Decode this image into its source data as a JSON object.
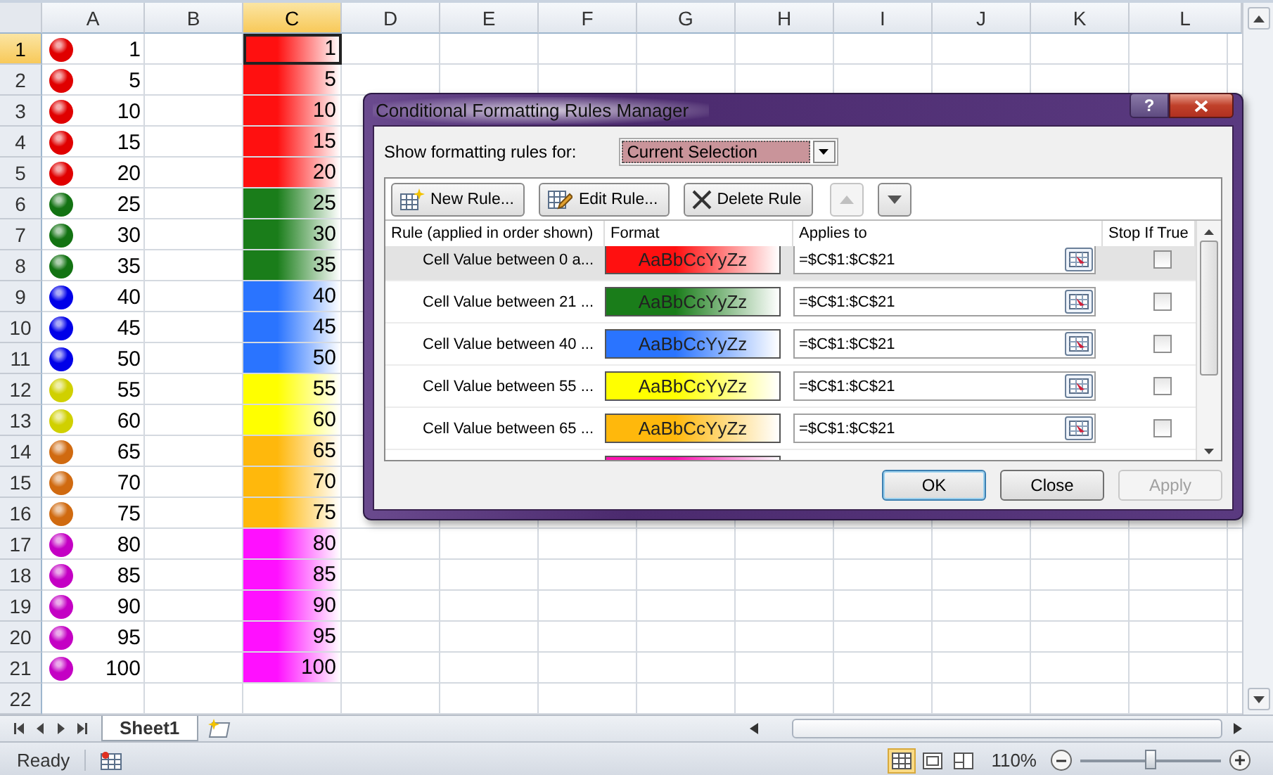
{
  "columns": [
    {
      "label": "A",
      "selected": false
    },
    {
      "label": "B",
      "selected": false
    },
    {
      "label": "C",
      "selected": true
    },
    {
      "label": "D",
      "selected": false
    },
    {
      "label": "E",
      "selected": false
    },
    {
      "label": "F",
      "selected": false
    },
    {
      "label": "G",
      "selected": false
    },
    {
      "label": "H",
      "selected": false
    },
    {
      "label": "I",
      "selected": false
    },
    {
      "label": "J",
      "selected": false
    },
    {
      "label": "K",
      "selected": false
    },
    {
      "label": "L",
      "selected": false
    }
  ],
  "rows": [
    {
      "number": "1",
      "selected": true,
      "dot": {
        "color": "#e00000"
      },
      "value_a": "1",
      "cell_c": {
        "value": "1",
        "color": "#ff1010"
      }
    },
    {
      "number": "2",
      "selected": false,
      "dot": {
        "color": "#e00000"
      },
      "value_a": "5",
      "cell_c": {
        "value": "5",
        "color": "#ff1010"
      }
    },
    {
      "number": "3",
      "selected": false,
      "dot": {
        "color": "#e00000"
      },
      "value_a": "10",
      "cell_c": {
        "value": "10",
        "color": "#ff1010"
      }
    },
    {
      "number": "4",
      "selected": false,
      "dot": {
        "color": "#e00000"
      },
      "value_a": "15",
      "cell_c": {
        "value": "15",
        "color": "#ff1010"
      }
    },
    {
      "number": "5",
      "selected": false,
      "dot": {
        "color": "#e00000"
      },
      "value_a": "20",
      "cell_c": {
        "value": "20",
        "color": "#ff1010"
      }
    },
    {
      "number": "6",
      "selected": false,
      "dot": {
        "color": "#137313"
      },
      "value_a": "25",
      "cell_c": {
        "value": "25",
        "color": "#1a7d1a"
      }
    },
    {
      "number": "7",
      "selected": false,
      "dot": {
        "color": "#137313"
      },
      "value_a": "30",
      "cell_c": {
        "value": "30",
        "color": "#1a7d1a"
      }
    },
    {
      "number": "8",
      "selected": false,
      "dot": {
        "color": "#137313"
      },
      "value_a": "35",
      "cell_c": {
        "value": "35",
        "color": "#1a7d1a"
      }
    },
    {
      "number": "9",
      "selected": false,
      "dot": {
        "color": "#0000e8"
      },
      "value_a": "40",
      "cell_c": {
        "value": "40",
        "color": "#2a74ff"
      }
    },
    {
      "number": "10",
      "selected": false,
      "dot": {
        "color": "#0000e8"
      },
      "value_a": "45",
      "cell_c": {
        "value": "45",
        "color": "#2a74ff"
      }
    },
    {
      "number": "11",
      "selected": false,
      "dot": {
        "color": "#0000e8"
      },
      "value_a": "50",
      "cell_c": {
        "value": "50",
        "color": "#2a74ff"
      }
    },
    {
      "number": "12",
      "selected": false,
      "dot": {
        "color": "#d0d000"
      },
      "value_a": "55",
      "cell_c": {
        "value": "55",
        "color": "#ffff00"
      }
    },
    {
      "number": "13",
      "selected": false,
      "dot": {
        "color": "#d0d000"
      },
      "value_a": "60",
      "cell_c": {
        "value": "60",
        "color": "#ffff00"
      }
    },
    {
      "number": "14",
      "selected": false,
      "dot": {
        "color": "#d06a10"
      },
      "value_a": "65",
      "cell_c": {
        "value": "65",
        "color": "#ffb80c"
      }
    },
    {
      "number": "15",
      "selected": false,
      "dot": {
        "color": "#d06a10"
      },
      "value_a": "70",
      "cell_c": {
        "value": "70",
        "color": "#ffb80c"
      }
    },
    {
      "number": "16",
      "selected": false,
      "dot": {
        "color": "#d06a10"
      },
      "value_a": "75",
      "cell_c": {
        "value": "75",
        "color": "#ffb80c"
      }
    },
    {
      "number": "17",
      "selected": false,
      "dot": {
        "color": "#c400c4"
      },
      "value_a": "80",
      "cell_c": {
        "value": "80",
        "color": "#ff10ff"
      }
    },
    {
      "number": "18",
      "selected": false,
      "dot": {
        "color": "#c400c4"
      },
      "value_a": "85",
      "cell_c": {
        "value": "85",
        "color": "#ff10ff"
      }
    },
    {
      "number": "19",
      "selected": false,
      "dot": {
        "color": "#c400c4"
      },
      "value_a": "90",
      "cell_c": {
        "value": "90",
        "color": "#ff10ff"
      }
    },
    {
      "number": "20",
      "selected": false,
      "dot": {
        "color": "#c400c4"
      },
      "value_a": "95",
      "cell_c": {
        "value": "95",
        "color": "#ff10ff"
      }
    },
    {
      "number": "21",
      "selected": false,
      "dot": {
        "color": "#c400c4"
      },
      "value_a": "100",
      "cell_c": {
        "value": "100",
        "color": "#ff10ff"
      }
    },
    {
      "number": "22",
      "selected": false
    }
  ],
  "sheet_tabs": [
    {
      "label": "Sheet1",
      "selected": true
    }
  ],
  "status_bar": {
    "status": "Ready",
    "views": [
      {
        "kind": "normal",
        "selected": true
      },
      {
        "kind": "layout",
        "selected": false
      },
      {
        "kind": "pagebreak",
        "selected": false
      }
    ],
    "zoom": "110%",
    "zoom_slider": {
      "level": 0.5
    }
  },
  "dialog": {
    "title": "Conditional Formatting Rules Manager",
    "help": "?",
    "filter_label": "Show formatting rules for:",
    "filter_value": "Current Selection",
    "toolbar": [
      {
        "kind": "new",
        "label": "New Rule..."
      },
      {
        "kind": "edit",
        "label": "Edit Rule..."
      },
      {
        "kind": "delete",
        "label": "Delete Rule"
      },
      {
        "kind": "up",
        "disabled": true
      },
      {
        "kind": "down",
        "disabled": false
      }
    ],
    "table_columns": [
      "Rule (applied in order shown)",
      "Format",
      "Applies to",
      "Stop If True"
    ],
    "rules": [
      {
        "rule": "Cell Value between 0 a...",
        "preview": "AaBbCcYyZz",
        "color": "#ff1010",
        "applies_to": "=$C$1:$C$21",
        "stop_if_true": false,
        "selected": true
      },
      {
        "rule": "Cell Value between 21 ...",
        "preview": "AaBbCcYyZz",
        "color": "#1a7d1a",
        "applies_to": "=$C$1:$C$21",
        "stop_if_true": false,
        "selected": false
      },
      {
        "rule": "Cell Value between 40 ...",
        "preview": "AaBbCcYyZz",
        "color": "#2a74ff",
        "applies_to": "=$C$1:$C$21",
        "stop_if_true": false,
        "selected": false
      },
      {
        "rule": "Cell Value between 55 ...",
        "preview": "AaBbCcYyZz",
        "color": "#ffff00",
        "applies_to": "=$C$1:$C$21",
        "stop_if_true": false,
        "selected": false
      },
      {
        "rule": "Cell Value between 65 ...",
        "preview": "AaBbCcYyZz",
        "color": "#ffb80c",
        "applies_to": "=$C$1:$C$21",
        "stop_if_true": false,
        "selected": false
      },
      {
        "color": "#ff10b0",
        "selected": false
      }
    ],
    "buttons": [
      {
        "label": "OK",
        "kind": "default",
        "disabled": false
      },
      {
        "label": "Close",
        "kind": "normal",
        "disabled": false
      },
      {
        "label": "Apply",
        "kind": "normal",
        "disabled": true
      }
    ]
  }
}
